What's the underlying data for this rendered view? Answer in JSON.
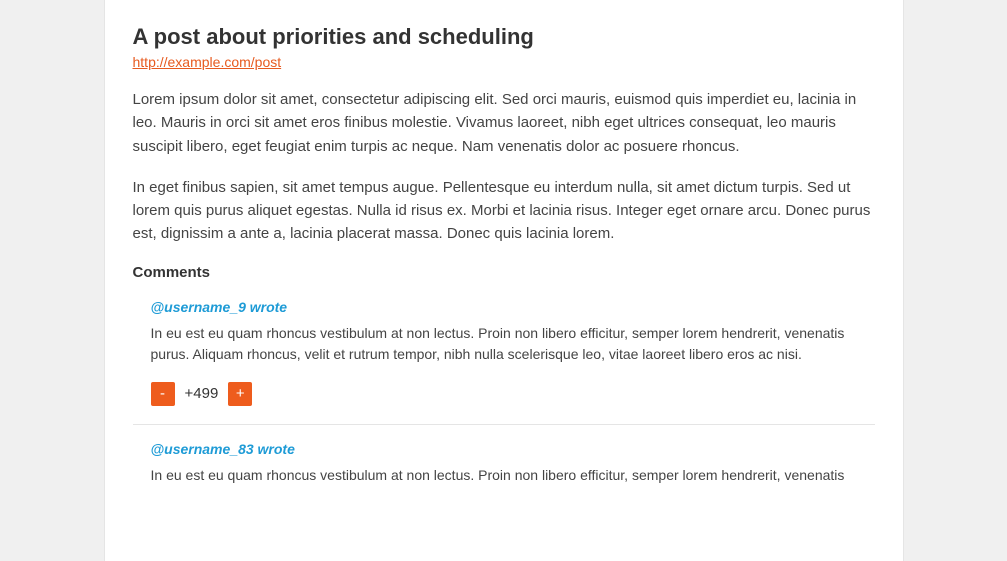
{
  "post": {
    "title": "A post about priorities and scheduling",
    "url": "http://example.com/post",
    "paragraphs": [
      "Lorem ipsum dolor sit amet, consectetur adipiscing elit. Sed orci mauris, euismod quis imperdiet eu, lacinia in leo. Mauris in orci sit amet eros finibus molestie. Vivamus laoreet, nibh eget ultrices consequat, leo mauris suscipit libero, eget feugiat enim turpis ac neque. Nam venenatis dolor ac posuere rhoncus.",
      "In eget finibus sapien, sit amet tempus augue. Pellentesque eu interdum nulla, sit amet dictum turpis. Sed ut lorem quis purus aliquet egestas. Nulla id risus ex. Morbi et lacinia risus. Integer eget ornare arcu. Donec purus est, dignissim a ante a, lacinia placerat massa. Donec quis lacinia lorem."
    ]
  },
  "comments_heading": "Comments",
  "vote_labels": {
    "down": "-",
    "up": "+"
  },
  "comments": [
    {
      "author_line": "@username_9 wrote",
      "body": "In eu est eu quam rhoncus vestibulum at non lectus. Proin non libero efficitur, semper lorem hendrerit, venenatis purus. Aliquam rhoncus, velit et rutrum tempor, nibh nulla scelerisque leo, vitae laoreet libero eros ac nisi.",
      "score": "+499"
    },
    {
      "author_line": "@username_83 wrote",
      "body": "In eu est eu quam rhoncus vestibulum at non lectus. Proin non libero efficitur, semper lorem hendrerit, venenatis",
      "score": ""
    }
  ]
}
